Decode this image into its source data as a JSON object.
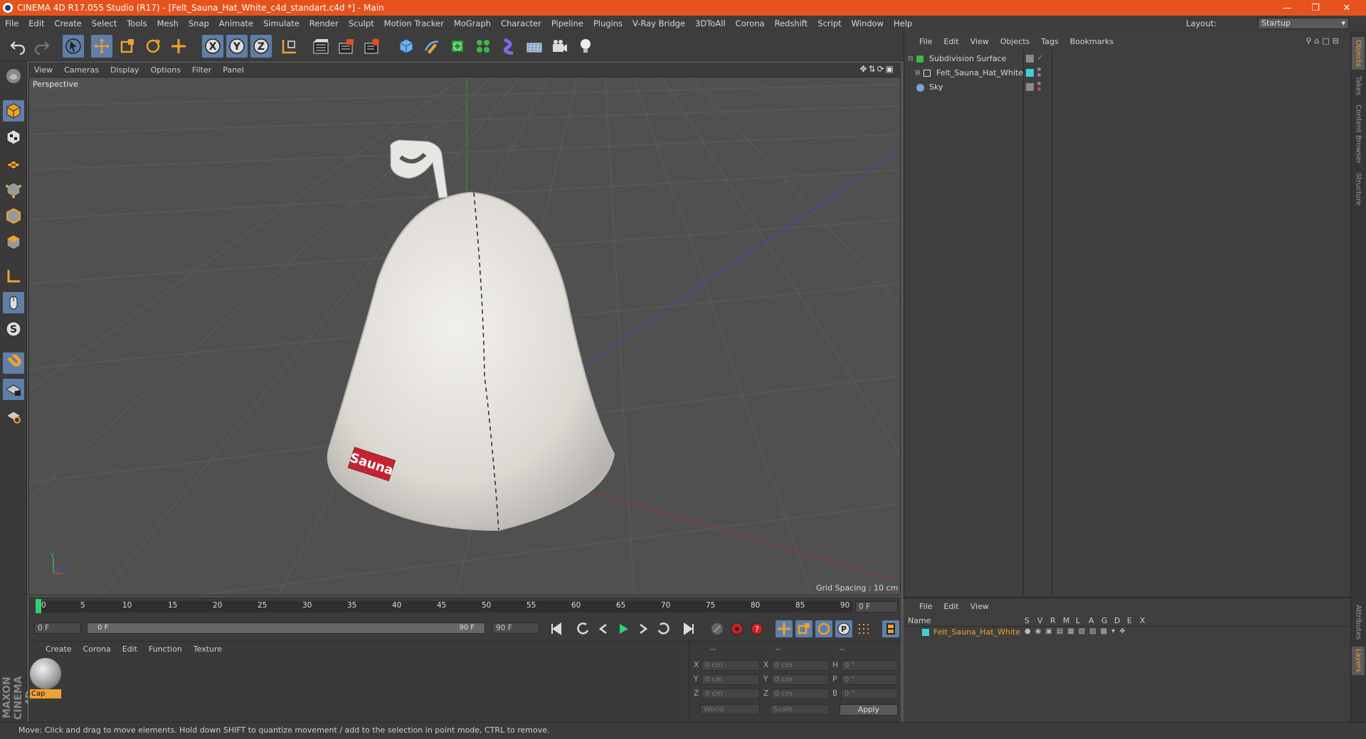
{
  "window": {
    "title": "CINEMA 4D R17.055 Studio (R17) - [Felt_Sauna_Hat_White_c4d_standart.c4d *] - Main"
  },
  "menu": [
    "File",
    "Edit",
    "Create",
    "Select",
    "Tools",
    "Mesh",
    "Snap",
    "Animate",
    "Simulate",
    "Render",
    "Sculpt",
    "Motion Tracker",
    "MoGraph",
    "Character",
    "Pipeline",
    "Plugins",
    "V-Ray Bridge",
    "3DToAll",
    "Corona",
    "Redshift",
    "Script",
    "Window",
    "Help"
  ],
  "layout": {
    "label": "Layout:",
    "value": "Startup"
  },
  "toolbar_icons": [
    "undo-icon",
    "redo-icon",
    "live-selection-icon",
    "move-icon",
    "scale-icon",
    "rotate-icon",
    "transform-icon",
    "x-axis-icon",
    "y-axis-icon",
    "z-axis-icon",
    "coordinate-system-icon",
    "render-view-icon",
    "render-picture-viewer-icon",
    "edit-render-settings-icon",
    "cube-icon",
    "pen-icon",
    "subdivision-icon",
    "array-icon",
    "deformer-icon",
    "floor-icon",
    "camera-icon",
    "light-icon"
  ],
  "viewport": {
    "menu": [
      "View",
      "Cameras",
      "Display",
      "Options",
      "Filter",
      "Panel"
    ],
    "label": "Perspective",
    "grid_spacing": "Grid Spacing : 10 cm",
    "hat_label": "Sauna"
  },
  "timeline": {
    "ticks": [
      "0",
      "5",
      "10",
      "15",
      "20",
      "25",
      "30",
      "35",
      "40",
      "45",
      "50",
      "55",
      "60",
      "65",
      "70",
      "75",
      "80",
      "85",
      "90"
    ],
    "current_frame_field": "0 F",
    "start_field": "0 F",
    "slider_left": "0 F",
    "slider_right": "90 F",
    "end_field": "90 F"
  },
  "material_panel": {
    "menu": [
      "Create",
      "Corona",
      "Edit",
      "Function",
      "Texture"
    ],
    "material_name": "Cap"
  },
  "coords": {
    "headers": [
      "--",
      "--",
      "--"
    ],
    "rows": [
      {
        "a": "X",
        "av": "0 cm",
        "b": "X",
        "bv": "0 cm",
        "c": "H",
        "cv": "0 °"
      },
      {
        "a": "Y",
        "av": "0 cm",
        "b": "Y",
        "bv": "0 cm",
        "c": "P",
        "cv": "0 °"
      },
      {
        "a": "Z",
        "av": "0 cm",
        "b": "Z",
        "bv": "0 cm",
        "c": "B",
        "cv": "0 °"
      }
    ],
    "world": "World",
    "scale": "Scale",
    "apply": "Apply"
  },
  "object_manager": {
    "menu": [
      "File",
      "Edit",
      "View",
      "Objects",
      "Tags",
      "Bookmarks"
    ],
    "objects": [
      "Subdivision Surface",
      "Felt_Sauna_Hat_White",
      "Sky"
    ]
  },
  "layer_manager": {
    "menu": [
      "File",
      "Edit",
      "View"
    ],
    "columns": [
      "Name",
      "S",
      "V",
      "R",
      "M",
      "L",
      "A",
      "G",
      "D",
      "E",
      "X"
    ],
    "layer_name": "Felt_Sauna_Hat_White"
  },
  "right_tabs": [
    "Objects",
    "Takes",
    "Content Browser",
    "Structure",
    "Attributes",
    "Layers"
  ],
  "status": "Move: Click and drag to move elements. Hold down SHIFT to quantize movement / add to the selection in point mode, CTRL to remove.",
  "brand": "MAXON CINEMA 4D",
  "colors": {
    "title_bar": "#e6521b",
    "accent_blue": "#5f7fa8",
    "layer_cyan": "#3fd0d8",
    "selection_orange": "#f0a030"
  }
}
